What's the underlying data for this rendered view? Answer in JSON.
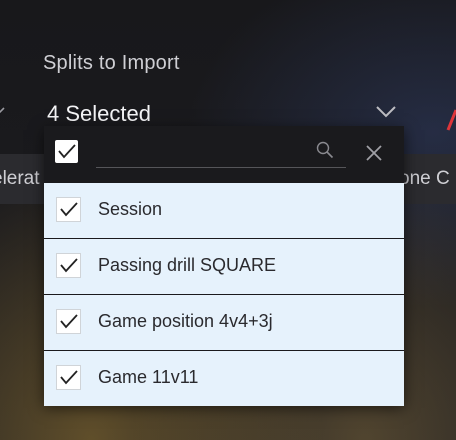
{
  "field": {
    "label": "Splits to Import",
    "selected_summary": "4 Selected"
  },
  "side_chips": {
    "left_text": "elerat",
    "right_text": "one C"
  },
  "dropdown": {
    "search_placeholder": "",
    "select_all_checked": true,
    "items": [
      {
        "label": "Session",
        "checked": true
      },
      {
        "label": "Passing drill SQUARE",
        "checked": true
      },
      {
        "label": "Game position 4v4+3j",
        "checked": true
      },
      {
        "label": "Game 11v11",
        "checked": true
      }
    ]
  },
  "colors": {
    "accent_red": "#e0353a",
    "list_bg": "#e6f2fc",
    "panel_bg": "#1a1a1d"
  },
  "icons": [
    "chevron-down-icon",
    "search-icon",
    "close-icon",
    "checkmark-icon"
  ]
}
